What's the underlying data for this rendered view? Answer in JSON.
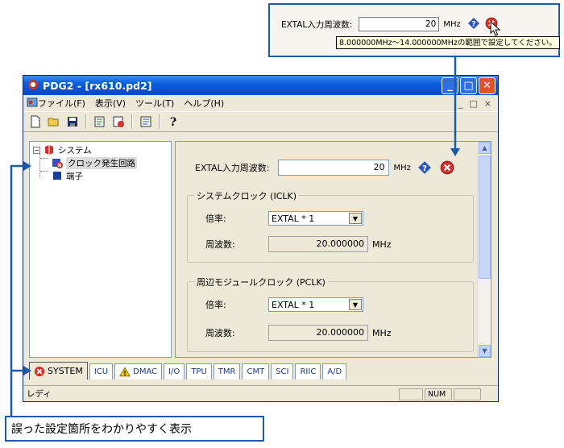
{
  "callout": {
    "label": "EXTAL入力周波数:",
    "value": "20",
    "unit": "MHz",
    "tooltip": "8.000000MHz〜14.000000MHzの範囲で設定してください。"
  },
  "window": {
    "title": "PDG2 - [rx610.pd2]",
    "menu": [
      "ファイル(F)",
      "表示(V)",
      "ツール(T)",
      "ヘルプ(H)"
    ],
    "mdi_buttons": [
      "_",
      "□",
      "×"
    ]
  },
  "tree": {
    "root": "システム",
    "expander": "−",
    "children": [
      "クロック発生回路",
      "端子"
    ]
  },
  "panel": {
    "extal_label": "EXTAL入力周波数:",
    "extal_value": "20",
    "extal_unit": "MHz",
    "iclk_group": "システムクロック (ICLK)",
    "iclk_rate_label": "倍率:",
    "iclk_rate_value": "EXTAL * 1",
    "iclk_freq_label": "周波数:",
    "iclk_freq_value": "20.000000",
    "iclk_freq_unit": "MHz",
    "pclk_group": "周辺モジュールクロック (PCLK)",
    "pclk_rate_label": "倍率:",
    "pclk_rate_value": "EXTAL * 1",
    "pclk_freq_label": "周波数:",
    "pclk_freq_value": "20.000000",
    "pclk_freq_unit": "MHz"
  },
  "tabs": [
    "SYSTEM",
    "ICU",
    "DMAC",
    "I/O",
    "TPU",
    "TMR",
    "CMT",
    "SCI",
    "RIIC",
    "A/D"
  ],
  "status": {
    "text": "レディ",
    "num": "NUM"
  },
  "annotation": {
    "note": "誤った設定箇所をわかりやすく表示"
  },
  "colors": {
    "accent": "#1f5aa8",
    "error": "#d9302b",
    "help": "#2a55c8"
  }
}
